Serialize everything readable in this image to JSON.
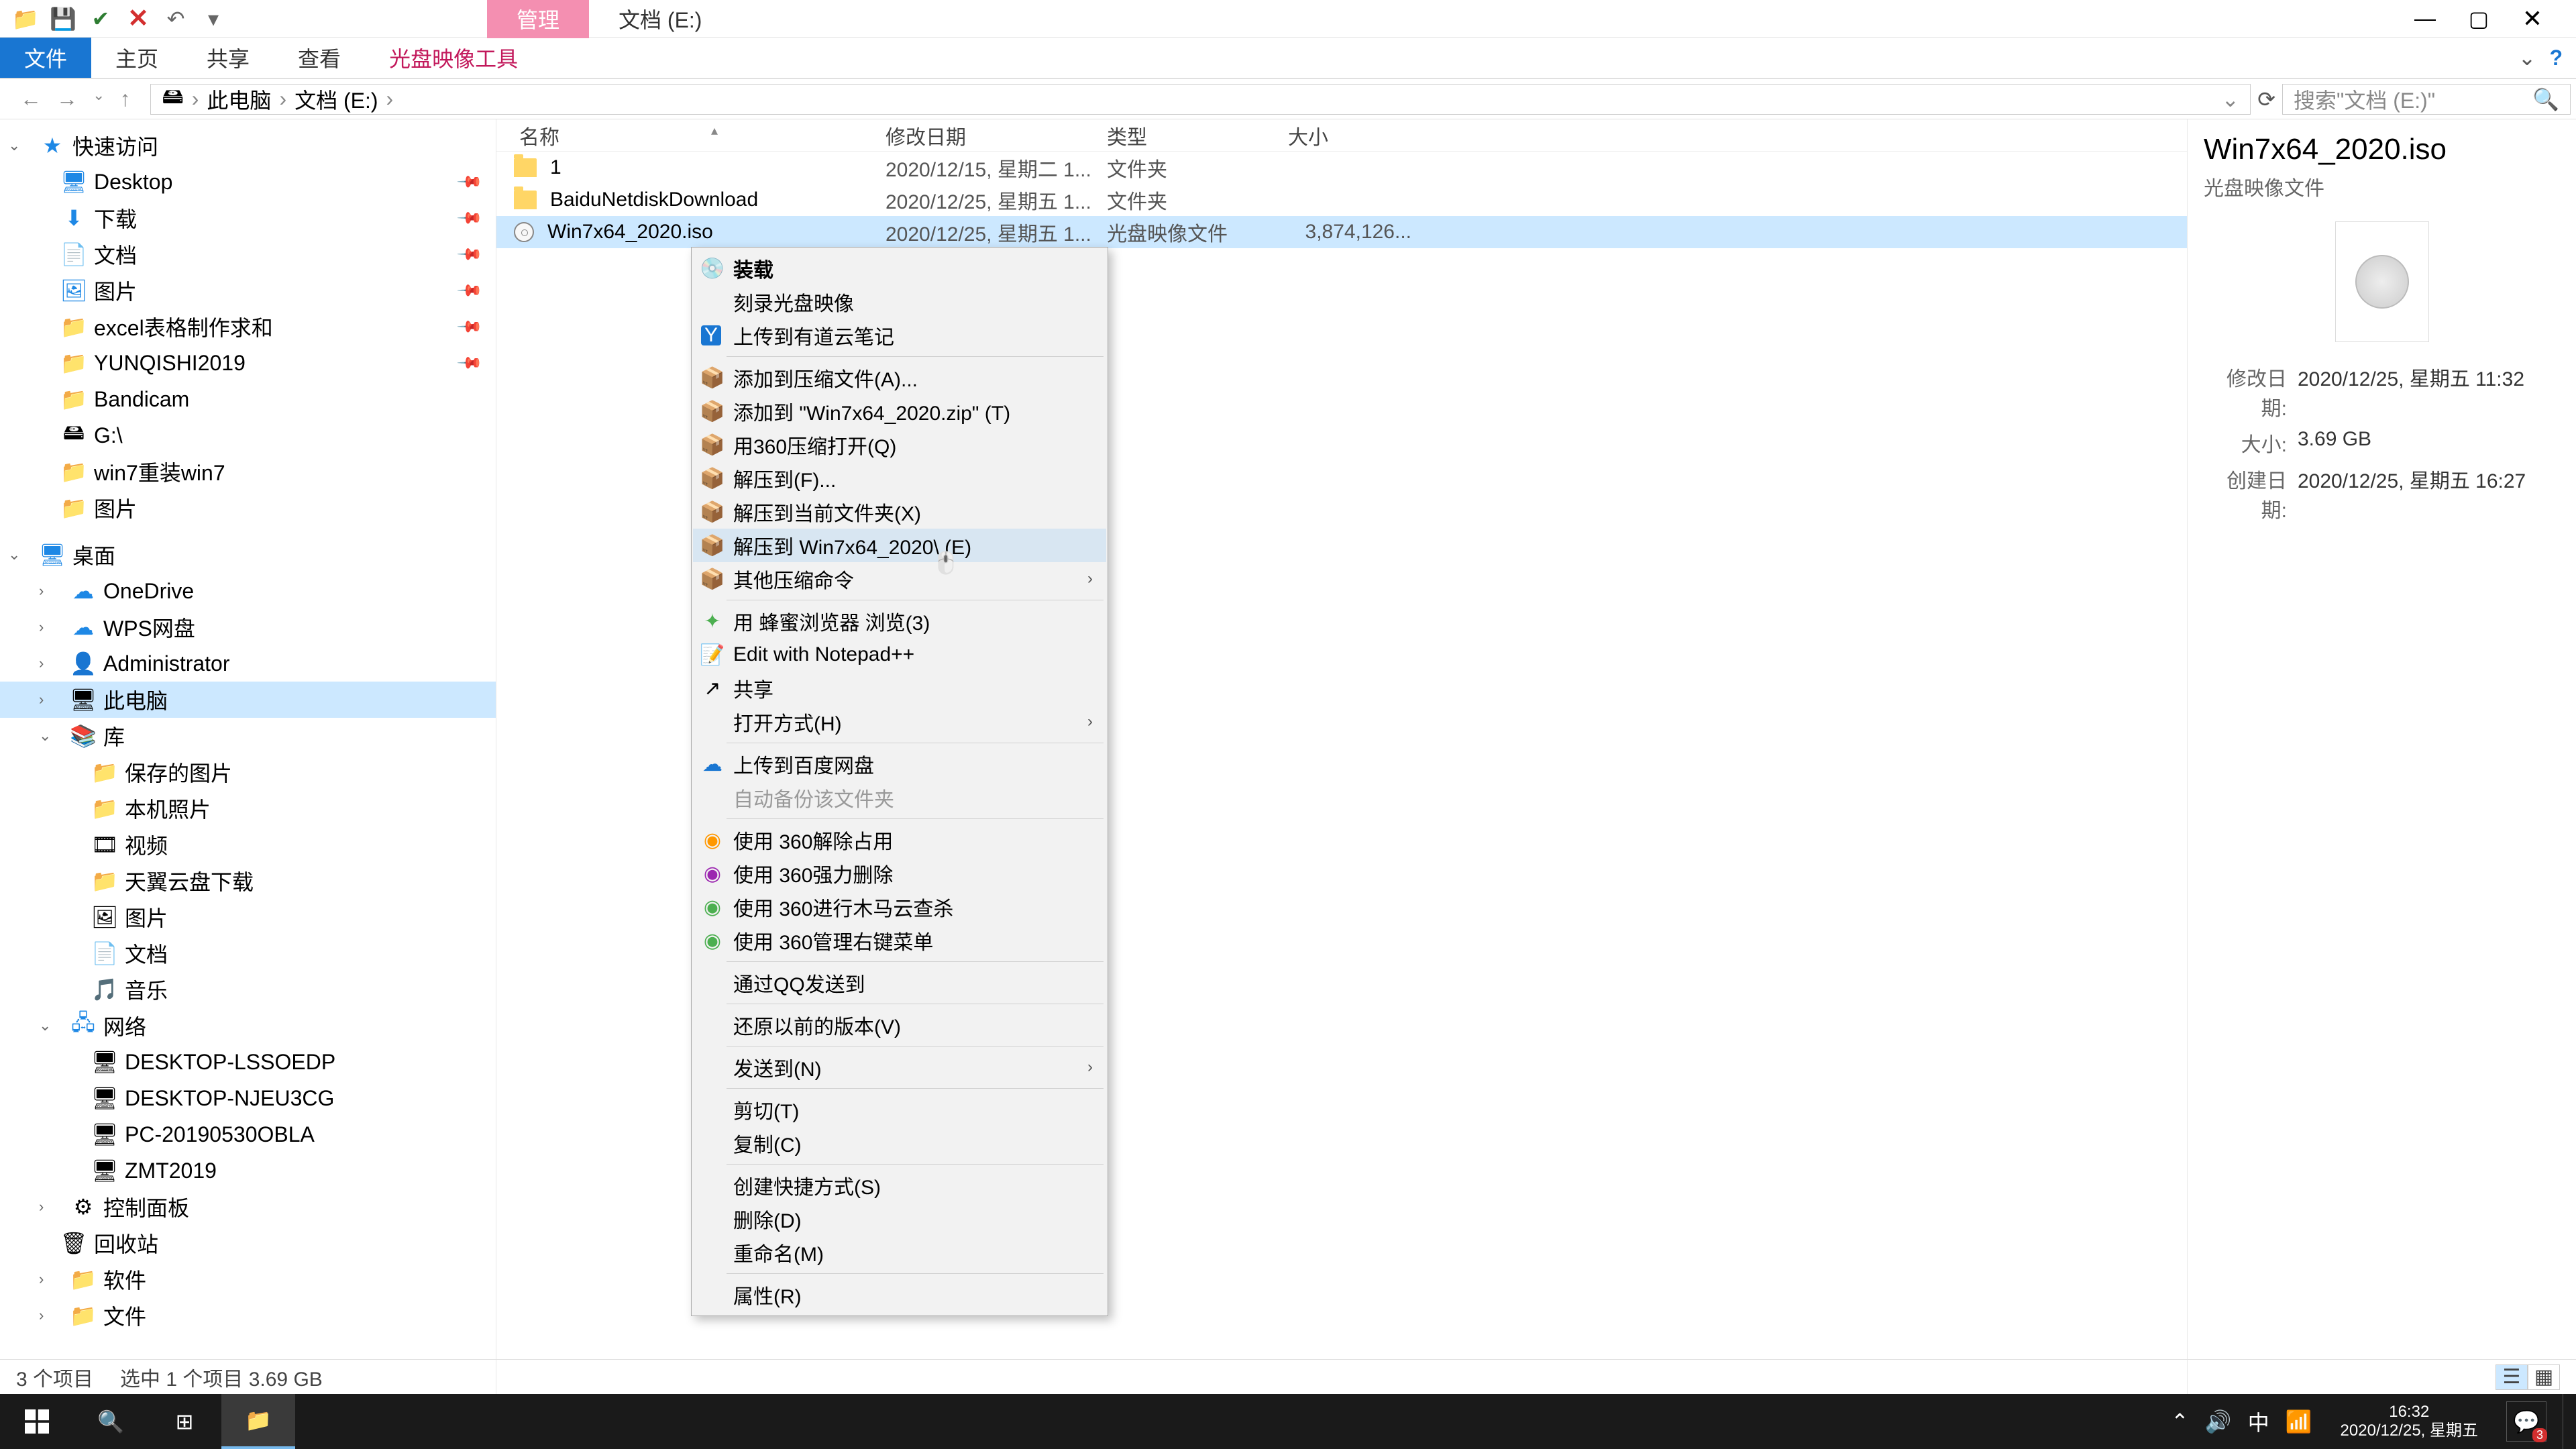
{
  "titlebar": {
    "tab_active": "管理",
    "tab_path": "文档 (E:)"
  },
  "ribbon": {
    "file": "文件",
    "home": "主页",
    "share": "共享",
    "view": "查看",
    "disc_tools": "光盘映像工具"
  },
  "breadcrumb": {
    "root": "此电脑",
    "item1": "文档 (E:)",
    "search_placeholder": "搜索\"文档 (E:)\""
  },
  "nav": {
    "quick": "快速访问",
    "desktop": "Desktop",
    "downloads": "下载",
    "documents": "文档",
    "pictures1": "图片",
    "excel": "excel表格制作求和",
    "yunqishi": "YUNQISHI2019",
    "bandicam": "Bandicam",
    "gdrive": "G:\\",
    "win7r": "win7重装win7",
    "pictures2": "图片",
    "desk_root": "桌面",
    "onedrive": "OneDrive",
    "wps": "WPS网盘",
    "admin": "Administrator",
    "thispc": "此电脑",
    "lib": "库",
    "saved": "保存的图片",
    "localp": "本机照片",
    "video": "视频",
    "tycloud": "天翼云盘下载",
    "pics3": "图片",
    "docs2": "文档",
    "music": "音乐",
    "network": "网络",
    "pc1": "DESKTOP-LSSOEDP",
    "pc2": "DESKTOP-NJEU3CG",
    "pc3": "PC-20190530OBLA",
    "pc4": "ZMT2019",
    "ctrl": "控制面板",
    "recycle": "回收站",
    "soft": "软件",
    "files": "文件"
  },
  "cols": {
    "name": "名称",
    "date": "修改日期",
    "type": "类型",
    "size": "大小"
  },
  "files": [
    {
      "name": "1",
      "date": "2020/12/15, 星期二 1...",
      "type": "文件夹",
      "size": ""
    },
    {
      "name": "BaiduNetdiskDownload",
      "date": "2020/12/25, 星期五 1...",
      "type": "文件夹",
      "size": ""
    },
    {
      "name": "Win7x64_2020.iso",
      "date": "2020/12/25, 星期五 1...",
      "type": "光盘映像文件",
      "size": "3,874,126..."
    }
  ],
  "ctx": {
    "mount": "装载",
    "burn": "刻录光盘映像",
    "youdao": "上传到有道云笔记",
    "addarchive": "添加到压缩文件(A)...",
    "addzip": "添加到 \"Win7x64_2020.zip\" (T)",
    "open360": "用360压缩打开(Q)",
    "ext1": "解压到(F)...",
    "ext2": "解压到当前文件夹(X)",
    "ext3": "解压到 Win7x64_2020\\ (E)",
    "other": "其他压缩命令",
    "bee": "用 蜂蜜浏览器 浏览(3)",
    "npp": "Edit with Notepad++",
    "share": "共享",
    "openwith": "打开方式(H)",
    "baidu": "上传到百度网盘",
    "autobackup": "自动备份该文件夹",
    "u1": "使用 360解除占用",
    "u2": "使用 360强力删除",
    "u3": "使用 360进行木马云查杀",
    "u4": "使用 360管理右键菜单",
    "qq": "通过QQ发送到",
    "restore": "还原以前的版本(V)",
    "sendto": "发送到(N)",
    "cut": "剪切(T)",
    "copy": "复制(C)",
    "shortcut": "创建快捷方式(S)",
    "delete": "删除(D)",
    "rename": "重命名(M)",
    "props": "属性(R)"
  },
  "details": {
    "title": "Win7x64_2020.iso",
    "subtitle": "光盘映像文件",
    "mod_label": "修改日期:",
    "mod_val": "2020/12/25, 星期五 11:32",
    "size_label": "大小:",
    "size_val": "3.69 GB",
    "created_label": "创建日期:",
    "created_val": "2020/12/25, 星期五 16:27"
  },
  "status": {
    "count": "3 个项目",
    "sel": "选中 1 个项目  3.69 GB"
  },
  "taskbar": {
    "time": "16:32",
    "date": "2020/12/25, 星期五",
    "ime": "中",
    "badge": "3"
  }
}
